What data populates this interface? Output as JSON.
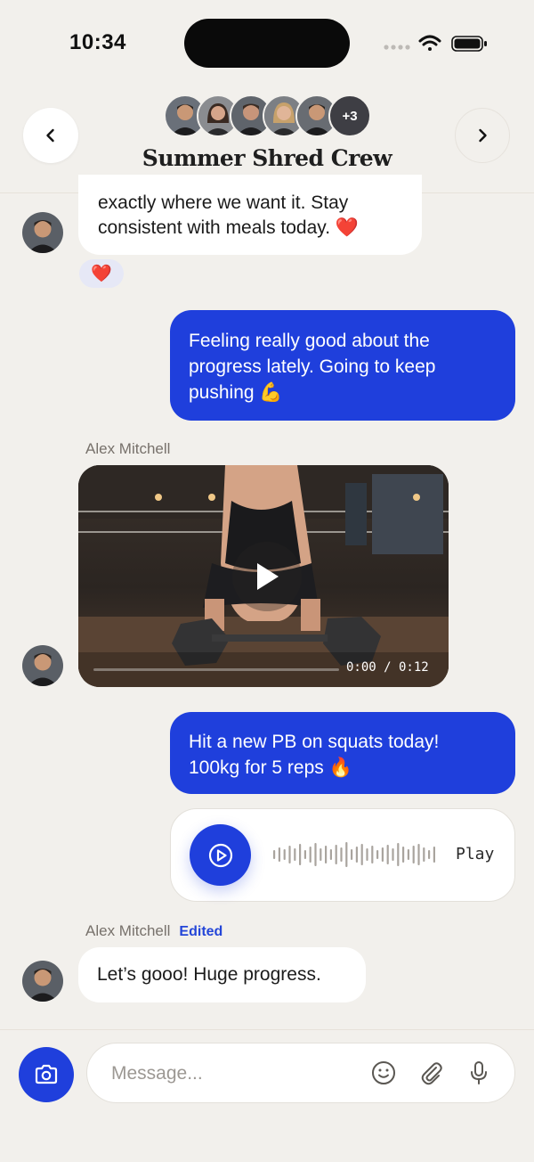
{
  "status_bar": {
    "time": "10:34"
  },
  "header": {
    "group_name": "Summer Shred Crew",
    "extra_members_label": "+3"
  },
  "messages": {
    "first_incoming_partial": "exactly where we want it. Stay consistent with meals today.",
    "first_incoming_line1": "exactly where we want it. Stay",
    "first_incoming_line2": "consistent with meals today. ❤️",
    "reaction": "❤️",
    "outgoing_1_line1": "Feeling really good about the",
    "outgoing_1_line2": "progress lately. Going to keep",
    "outgoing_1_line3": "pushing 💪",
    "video_sender": "Alex Mitchell",
    "video_time": "0:00 / 0:12",
    "outgoing_2_line1": "Hit a new PB on squats today!",
    "outgoing_2_line2": "100kg for 5 reps 🔥",
    "voice_label": "Play",
    "last_sender": "Alex Mitchell",
    "last_edited": "Edited",
    "last_incoming": "Let’s gooo! Huge progress."
  },
  "composer": {
    "placeholder": "Message..."
  },
  "colors": {
    "accent": "#1f3fdc",
    "background": "#f2f0ec",
    "bubble_in": "#ffffff"
  },
  "icons": [
    "signal-icon",
    "wifi-icon",
    "battery-icon",
    "chevron-left-icon",
    "chevron-right-icon",
    "play-icon",
    "camera-icon",
    "emoji-icon",
    "paperclip-icon",
    "microphone-icon"
  ]
}
